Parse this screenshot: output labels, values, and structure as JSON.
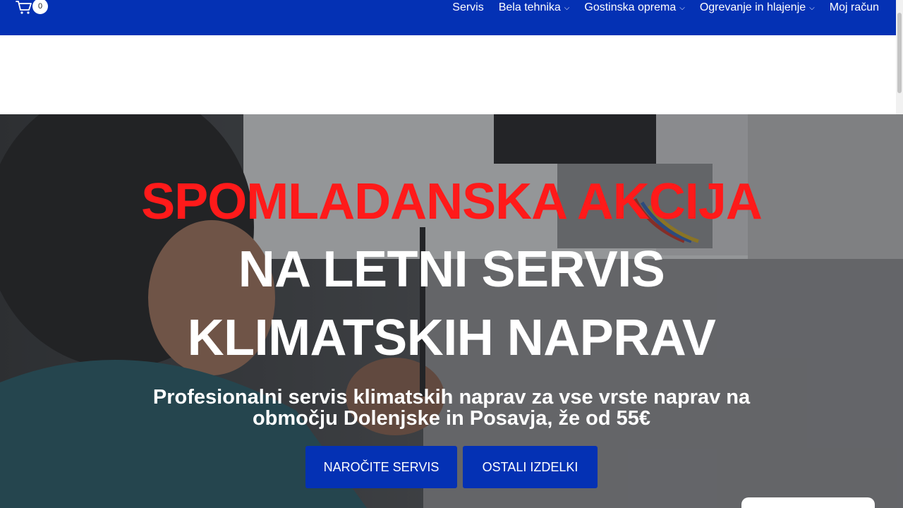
{
  "header": {
    "cart_count": "0",
    "nav": [
      {
        "label": "Servis",
        "has_dropdown": false
      },
      {
        "label": "Bela tehnika",
        "has_dropdown": true
      },
      {
        "label": "Gostinska oprema",
        "has_dropdown": true
      },
      {
        "label": "Ogrevanje in hlajenje",
        "has_dropdown": true
      },
      {
        "label": "Moj račun",
        "has_dropdown": false
      }
    ],
    "chevron": "⌵"
  },
  "hero": {
    "headline_red": "SPOMLADANSKA AKCIJA",
    "headline_line1": "NA LETNI SERVIS",
    "headline_line2": "KLIMATSKIH NAPRAV",
    "subtitle": "Profesionalni servis klimatskih naprav za vse vrste naprav na območju Dolenjske in Posavja, že od 55€",
    "buttons": [
      {
        "label": "NAROČITE SERVIS"
      },
      {
        "label": "OSTALI IZDELKI"
      }
    ]
  },
  "colors": {
    "brand_blue": "#0431b4",
    "headline_red": "#ff1a1a",
    "text_white": "#ffffff"
  },
  "icons": {
    "cart": "cart-icon",
    "dropdown": "chevron-down-icon"
  }
}
